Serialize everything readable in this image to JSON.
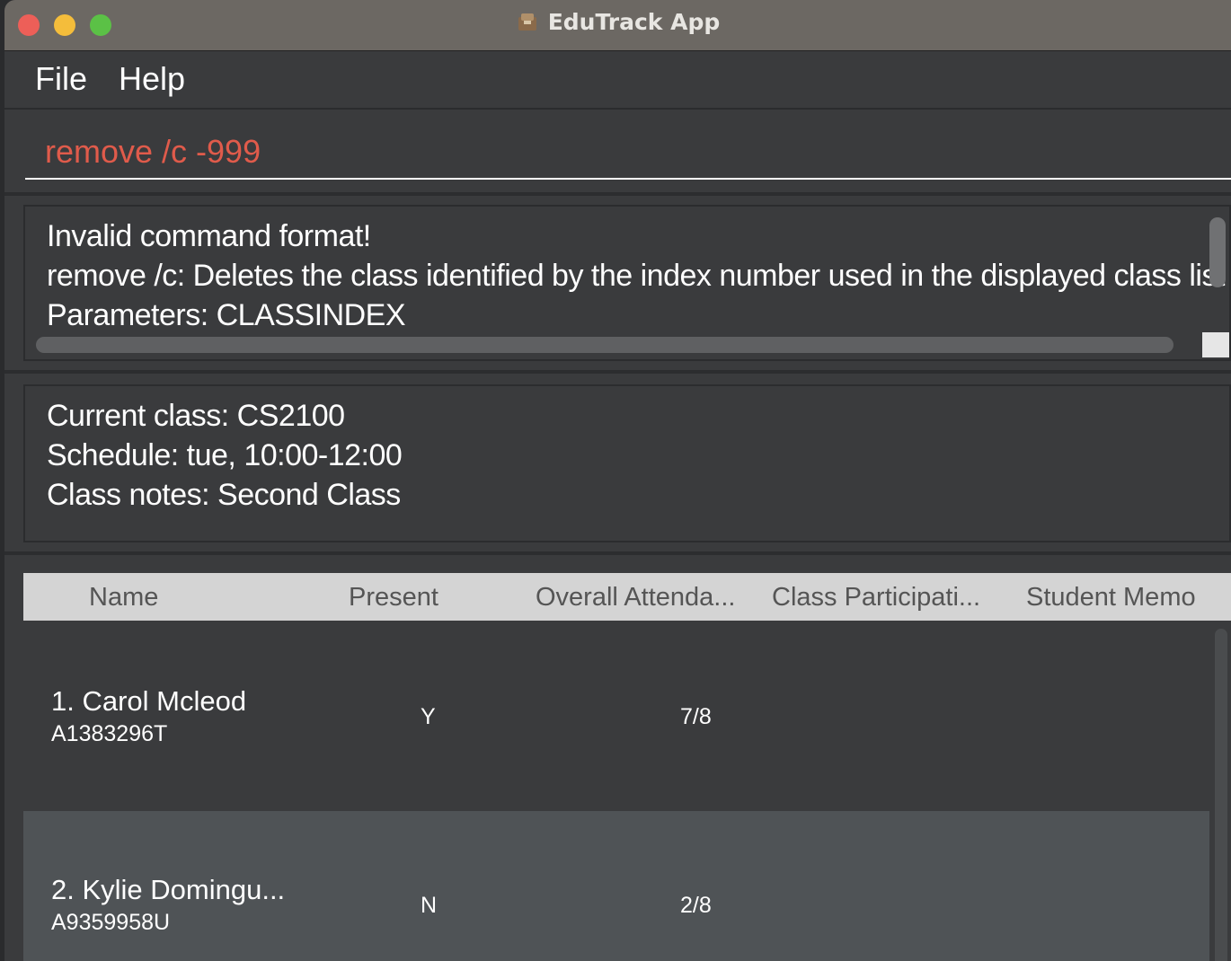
{
  "window": {
    "title": "EduTrack App"
  },
  "menu": {
    "items": [
      "File",
      "Help"
    ]
  },
  "command": {
    "value": "remove /c -999"
  },
  "result": {
    "lines": [
      "Invalid command format!",
      "remove /c: Deletes the class identified by the index number used in the displayed class list",
      "Parameters: CLASSINDEX"
    ]
  },
  "class_info": {
    "lines": [
      "Current class: CS2100",
      "Schedule: tue, 10:00-12:00",
      "Class notes: Second Class"
    ]
  },
  "table": {
    "columns": [
      "Name",
      "Present",
      "Overall Attenda...",
      "Class Participati...",
      "Student Memo"
    ],
    "rows": [
      {
        "name": "1.  Carol Mcleod",
        "id": "A1383296T",
        "present": "Y",
        "attendance": "7/8"
      },
      {
        "name": "2.  Kylie Domingu...",
        "id": "A9359958U",
        "present": "N",
        "attendance": "2/8"
      }
    ]
  },
  "colors": {
    "command_text": "#e05b4b",
    "titlebar": "#6c6863",
    "background": "#3a3b3d",
    "header": "#d4d4d4",
    "row_alt": "#4f5356"
  }
}
